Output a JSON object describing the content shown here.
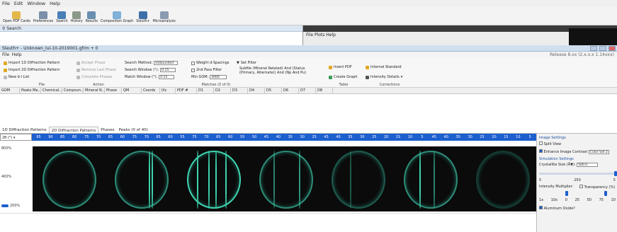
{
  "main_menu": [
    "File",
    "Edit",
    "Window",
    "Help"
  ],
  "toolbar": [
    "Open PDF Cards",
    "Preferences",
    "Search",
    "History",
    "Results",
    "Composition Graph",
    "Sleuth+",
    "Microanalysis"
  ],
  "search_title": "Search",
  "bg_window": {
    "menu": "File  Plots  Help"
  },
  "sleuth_title": "Sleuth+ - Unknown_lul-10-2019001.gfrm + 0",
  "sleuth_menu": [
    "File",
    "Help"
  ],
  "version": "Release 8.xx (2.x.x.x 1.14xxx)",
  "ribbon": {
    "file": {
      "items": [
        "Import 1D Diffraction Pattern",
        "Import 2D Diffraction Pattern",
        "New d-I List"
      ],
      "label": "File"
    },
    "action": {
      "items": [
        "Accept Phase",
        "Remove Last Phase",
        "Complete Phases"
      ],
      "label": "Action"
    },
    "matches": {
      "search_method_label": "Search Method:",
      "search_method_value": "Unbounded",
      "search_window_label": "Search Window (°):",
      "search_window_value": "0.15",
      "match_window_label": "Match Window (°):",
      "match_window_value": "0.15",
      "weight_label": "Weight d-Spacings",
      "set_filter_label": "Set Filter",
      "second_pass_label": "2nd Pass Filter",
      "min_gom_label": "Min GOM:",
      "min_gom_value": "3000",
      "filter_desc": "Subfile (Mineral Related) And (Status (Primary, Alternate)) And (Np And Pu)",
      "label": "Matches (0 of 0)"
    },
    "table": {
      "items": [
        "Insert PDF",
        "Create Graph"
      ],
      "label": "Table"
    },
    "corrections": {
      "items": [
        "Internal Standard",
        "Intensity Details"
      ],
      "label": "Corrections"
    }
  },
  "table_columns": [
    "GOM",
    "Peaks Ma...",
    "Chemical...",
    "Compoun...",
    "Mineral N...",
    "Phase",
    "QM",
    "Coords",
    "I/Ic",
    "PDF #",
    "D1",
    "D2",
    "D3",
    "D4",
    "D5",
    "D6",
    "D7",
    "D8"
  ],
  "tabs": [
    "1D Diffraction Patterns",
    "2D Diffraction Patterns",
    "Phases",
    "Peaks (0 of 40)"
  ],
  "active_tab": 1,
  "angle_axis_label": "2θ (°)",
  "angle_labels": [
    "95",
    "90",
    "85",
    "80",
    "75",
    "70",
    "65",
    "60",
    "75",
    "70",
    "65",
    "60",
    "55",
    "75",
    "70",
    "65",
    "60",
    "55",
    "50",
    "45",
    "40",
    "35",
    "30",
    "25",
    "45",
    "40",
    "35",
    "30",
    "25",
    "20",
    "15",
    "10",
    "5",
    "45",
    "40",
    "35",
    "30",
    "25",
    "20",
    "15",
    "10",
    "5"
  ],
  "y_labels": [
    "800%",
    "400%",
    "200%"
  ],
  "right_panel": {
    "image_settings": "Image Settings",
    "split_view": "Split View",
    "enhance_contrast": "Enhance Image Contrast",
    "color_set": "Color Set 2",
    "simulation_settings": "Simulation Settings",
    "crystallite_label": "Crystallite Size (Å▼):",
    "crystallite_value": "500.0",
    "scale_a": [
      "5",
      "250",
      "5"
    ],
    "intensity_label": "Intensity Multiplier:",
    "transparency_label": "Transparency (%)",
    "scale_b": [
      "1x",
      "10x",
      "0",
      "25",
      "50",
      "75",
      "10"
    ],
    "aluminum": "Aluminum Oxide?"
  },
  "colors": {
    "accent": "#1c5fcf",
    "ring": "#3ed6b0"
  }
}
